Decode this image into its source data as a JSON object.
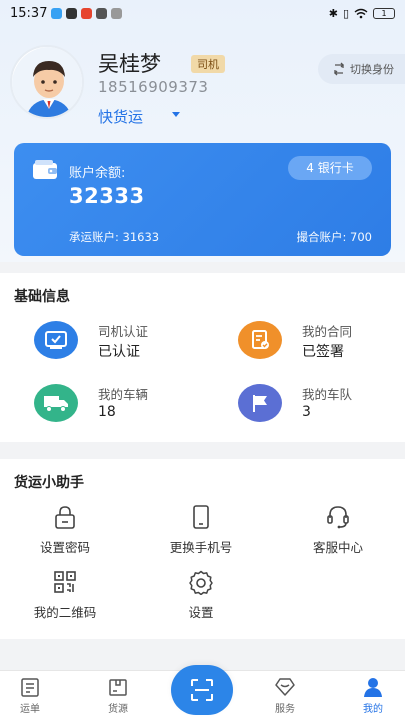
{
  "status_bar": {
    "time": "15:37",
    "battery": "1"
  },
  "profile": {
    "name": "吴桂梦",
    "role_badge": "司机",
    "phone": "18516909373",
    "company": "快货运",
    "switch_identity": "切换身份"
  },
  "account": {
    "balance_label": "账户余额:",
    "balance_value": "32333",
    "bank_card_label": "4 银行卡",
    "carrier_account": "承运账户: 31633",
    "match_account": "撮合账户: 700"
  },
  "basic_info": {
    "title": "基础信息",
    "items": [
      {
        "label": "司机认证",
        "value": "已认证",
        "icon": "id-card-icon",
        "color": "#2d7fe6"
      },
      {
        "label": "我的合同",
        "value": "已签署",
        "icon": "contract-icon",
        "color": "#f0902a"
      },
      {
        "label": "我的车辆",
        "value": "18",
        "icon": "truck-icon",
        "color": "#33b48a"
      },
      {
        "label": "我的车队",
        "value": "3",
        "icon": "flag-icon",
        "color": "#5b6fd4"
      }
    ]
  },
  "assistant": {
    "title": "货运小助手",
    "tools": [
      {
        "label": "设置密码",
        "icon": "lock-icon"
      },
      {
        "label": "更换手机号",
        "icon": "phone-icon"
      },
      {
        "label": "客服中心",
        "icon": "headset-icon"
      },
      {
        "label": "我的二维码",
        "icon": "qrcode-icon"
      },
      {
        "label": "设置",
        "icon": "gear-icon"
      }
    ]
  },
  "tab_bar": {
    "tabs": [
      {
        "label": "运单",
        "icon": "waybill-icon"
      },
      {
        "label": "货源",
        "icon": "cargo-icon"
      },
      {
        "label": "服务",
        "icon": "service-icon"
      },
      {
        "label": "我的",
        "icon": "profile-icon"
      }
    ],
    "active": "我的",
    "accent": "#2473e6"
  }
}
